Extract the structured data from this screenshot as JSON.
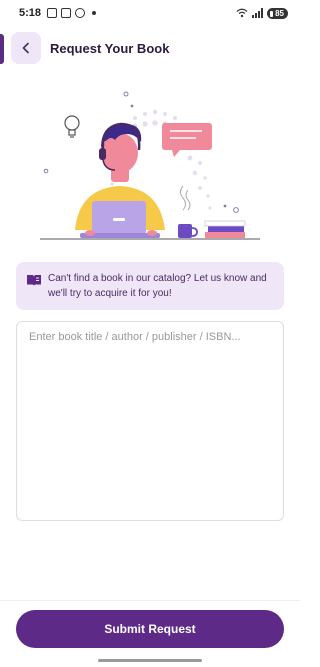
{
  "status_bar": {
    "time": "5:18",
    "battery": "85"
  },
  "header": {
    "title": "Request Your Book",
    "back_icon": "chevron-left-icon"
  },
  "info_banner": {
    "icon": "book-open-icon",
    "text": "Can't find a book in our catalog? Let us know and we'll try to acquire it for you!"
  },
  "request_input": {
    "placeholder": "Enter book title / author / publisher / ISBN...",
    "value": ""
  },
  "submit": {
    "label": "Submit Request"
  },
  "colors": {
    "primary": "#5e2a88",
    "accent_bg": "#efe6f7",
    "illustration_pink": "#f08a9a",
    "illustration_yellow": "#f7c948"
  }
}
